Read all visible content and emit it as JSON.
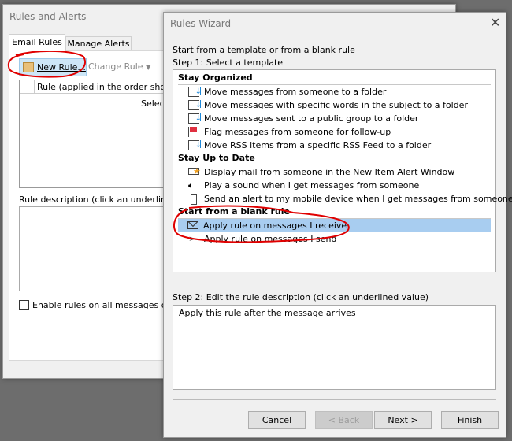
{
  "rules_alerts": {
    "title": "Rules and Alerts",
    "tabs": [
      {
        "label": "Email Rules",
        "active": true
      },
      {
        "label": "Manage Alerts",
        "active": false
      }
    ],
    "toolbar": {
      "new_rule": "New Rule...",
      "change_rule": "Change Rule"
    },
    "column_header": "Rule (applied in the order shown)",
    "list_placeholder": "Select t",
    "description_label": "Rule description (click an underlined",
    "enable_checkbox": {
      "label": "Enable rules on all messages dow",
      "checked": false
    }
  },
  "wizard": {
    "title": "Rules Wizard",
    "intro": "Start from a template or from a blank rule",
    "step1": "Step 1: Select a template",
    "groups": [
      {
        "header": "Stay Organized",
        "items": [
          {
            "label": "Move messages from someone to a folder",
            "icon": "move-to-folder-icon"
          },
          {
            "label": "Move messages with specific words in the subject to a folder",
            "icon": "move-to-folder-icon"
          },
          {
            "label": "Move messages sent to a public group to a folder",
            "icon": "move-to-folder-icon"
          },
          {
            "label": "Flag messages from someone for follow-up",
            "icon": "flag-icon"
          },
          {
            "label": "Move RSS items from a specific RSS Feed to a folder",
            "icon": "move-to-folder-icon"
          }
        ]
      },
      {
        "header": "Stay Up to Date",
        "items": [
          {
            "label": "Display mail from someone in the New Item Alert Window",
            "icon": "mail-star-icon"
          },
          {
            "label": "Play a sound when I get messages from someone",
            "icon": "speaker-icon"
          },
          {
            "label": "Send an alert to my mobile device when I get messages from someone",
            "icon": "mobile-icon"
          }
        ]
      },
      {
        "header": "Start from a blank rule",
        "items": [
          {
            "label": "Apply rule on messages I receive",
            "icon": "envelope-icon",
            "selected": true
          },
          {
            "label": "Apply rule on messages I send",
            "icon": "send-icon"
          }
        ]
      }
    ],
    "step2": "Step 2: Edit the rule description (click an underlined value)",
    "description": "Apply this rule after the message arrives",
    "buttons": {
      "cancel": "Cancel",
      "back": "< Back",
      "next": "Next >",
      "finish": "Finish"
    },
    "close_icon": "close-icon"
  },
  "colors": {
    "selection": "#a8cdf0",
    "annotation": "#e00000",
    "accent": "#1e88d8"
  }
}
